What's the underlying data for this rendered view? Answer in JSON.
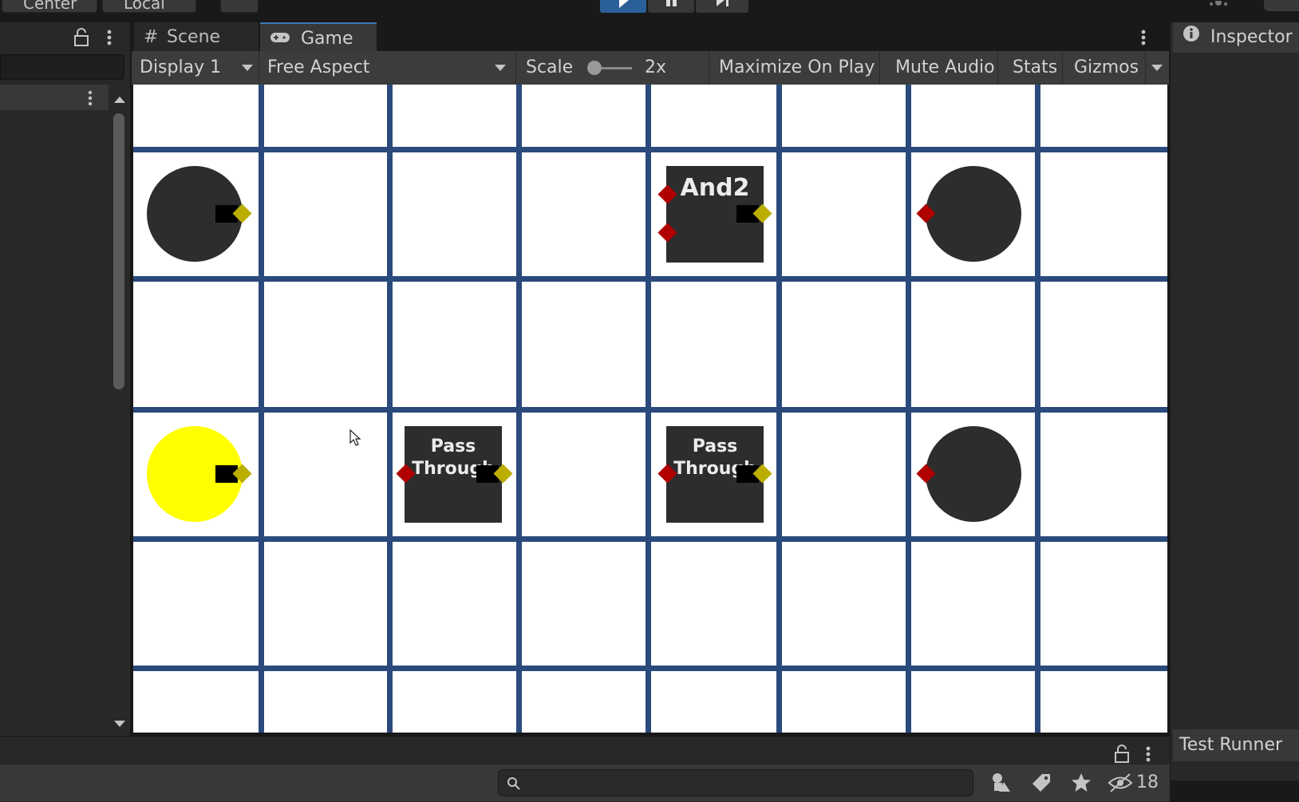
{
  "toolbar": {
    "center_label": "Center",
    "local_label": "Local"
  },
  "tabs": [
    {
      "label": "Scene",
      "icon": "hash-icon"
    },
    {
      "label": "Game",
      "icon": "gamepad-icon"
    }
  ],
  "game_toolbar": {
    "display": "Display 1",
    "aspect": "Free Aspect",
    "scale_label": "Scale",
    "scale_value": "2x",
    "scale_slider_level": 0,
    "maximize": "Maximize On Play",
    "mute": "Mute Audio",
    "stats": "Stats",
    "gizmos": "Gizmos"
  },
  "grid": {
    "columns": 8,
    "rows": 5
  },
  "gates": {
    "and2": {
      "label": "And2"
    },
    "pass1": {
      "label_line1": "Pass",
      "label_line2": "Through"
    },
    "pass2": {
      "label_line1": "Pass",
      "label_line2": "Through"
    }
  },
  "nodes": {
    "input_top": {
      "state": "off",
      "color": "#2d2d2d"
    },
    "input_bottom": {
      "state": "on",
      "color": "#ffff00"
    },
    "output_top": {
      "state": "off"
    },
    "output_bottom": {
      "state": "off"
    }
  },
  "colors": {
    "grid_line": "#2b4a7c",
    "input_pin": "#b00000",
    "output_pin": "#bcae00",
    "active_node": "#ffff00",
    "accent_play": "#2b5f9a"
  },
  "right_panel": {
    "inspector": "Inspector",
    "test_runner": "Test Runner"
  },
  "bottom": {
    "hidden_count": "18"
  }
}
